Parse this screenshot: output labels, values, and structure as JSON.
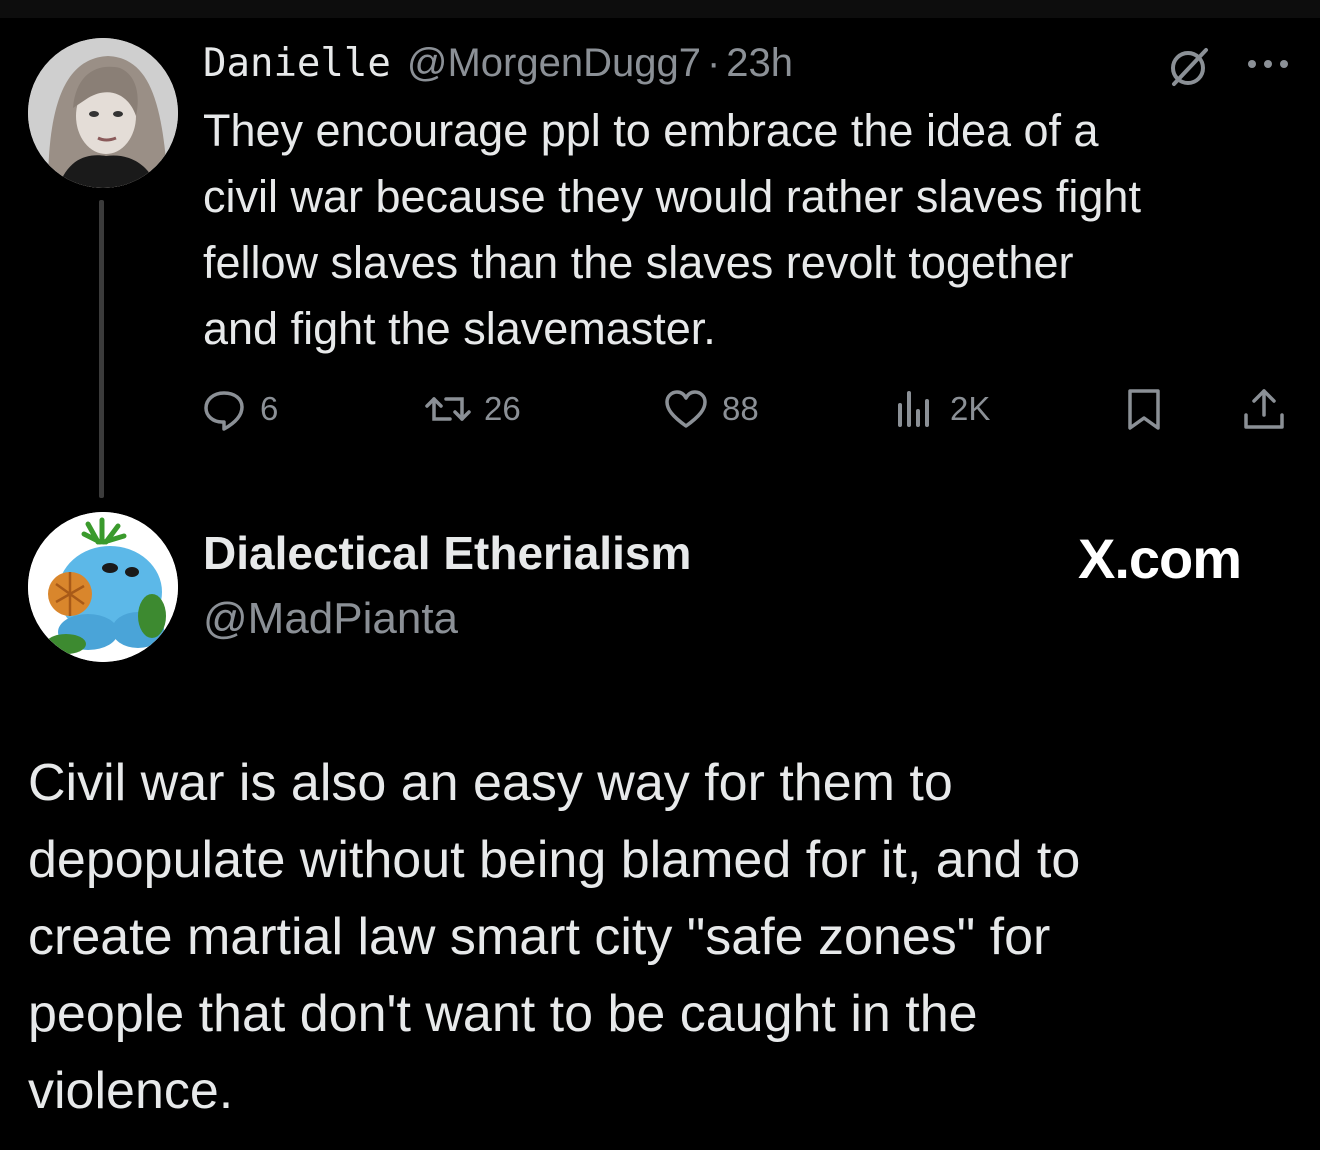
{
  "parent_tweet": {
    "display_name": "Danielle",
    "handle": "@MorgenDugg7",
    "separator": "·",
    "time": "23h",
    "text_lines": [
      "They encourage ppl to embrace the idea of a",
      "civil war because they would rather slaves fight",
      "fellow slaves than the slaves revolt together",
      "and fight the slavemaster."
    ],
    "actions": {
      "replies": "6",
      "reposts": "26",
      "likes": "88",
      "views": "2K"
    },
    "icons": [
      "no-ai-icon",
      "more-icon",
      "reply-icon",
      "repost-icon",
      "like-icon",
      "views-icon",
      "bookmark-icon",
      "share-icon"
    ]
  },
  "reply_tweet": {
    "display_name": "Dialectical Etherialism",
    "handle": "@MadPianta",
    "brand": "X.com",
    "text_lines": [
      "Civil war is also an easy way for them to",
      "depopulate without being blamed for it, and to",
      "create martial law smart city \"safe zones\" for",
      "people that don't want to be caught in the",
      "violence."
    ]
  },
  "colors": {
    "background": "#000000",
    "primary_text": "#e7e9ea",
    "secondary_text": "#8b9096",
    "thread_line": "#3b3b3b"
  }
}
